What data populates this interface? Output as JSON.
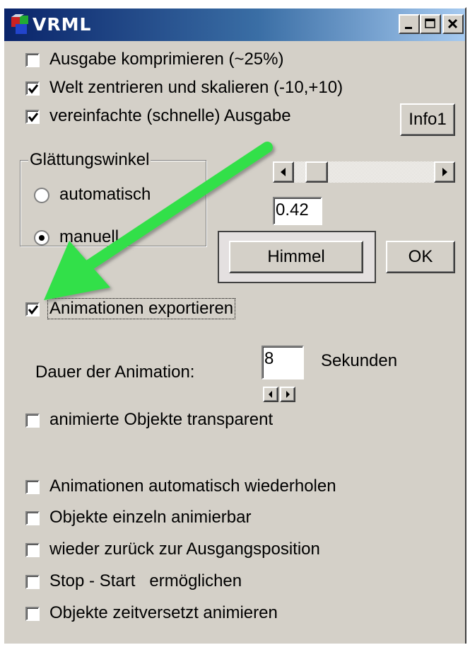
{
  "window": {
    "title": "VRML",
    "controls": [
      "minimize",
      "maximize",
      "close"
    ]
  },
  "options_top": [
    {
      "label": "Ausgabe komprimieren (~25%)",
      "checked": false
    },
    {
      "label": "Welt zentrieren und skalieren (-10,+10)",
      "checked": true
    },
    {
      "label": "vereinfachte (schnelle) Ausgabe",
      "checked": true
    }
  ],
  "info_button": "Info1",
  "smoothing_group": {
    "title": "Glättungswinkel",
    "options": [
      {
        "label": "automatisch",
        "selected": false
      },
      {
        "label": "manuell",
        "selected": true
      }
    ]
  },
  "smoothing_slider": {
    "value_fraction": 0.07
  },
  "smoothing_value": "0.42",
  "himmel_button": "Himmel",
  "ok_button": "OK",
  "animation_export": {
    "label": "Animationen exportieren",
    "checked": true
  },
  "duration": {
    "label": "Dauer der Animation:",
    "value": "8",
    "unit": "Sekunden"
  },
  "options_bottom": [
    {
      "label": "animierte Objekte transparent",
      "checked": false
    },
    {
      "label": "Animationen automatisch wiederholen",
      "checked": false
    },
    {
      "label": "Objekte einzeln animierbar",
      "checked": false
    },
    {
      "label": "wieder zurück zur Ausgangsposition",
      "checked": false
    },
    {
      "label": "Stop - Start   ermöglichen",
      "checked": false
    },
    {
      "label": "Objekte zeitversetzt animieren",
      "checked": false
    }
  ],
  "annotation_arrow_color": "#33e04a"
}
